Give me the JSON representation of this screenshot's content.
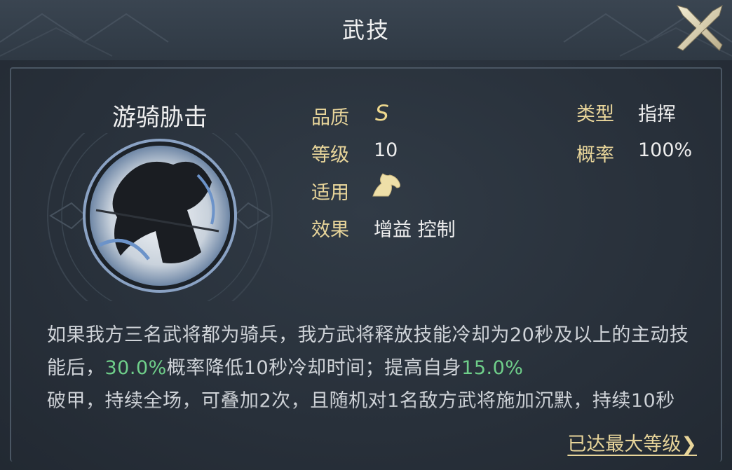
{
  "header": {
    "title": "武技"
  },
  "skill": {
    "name": "游骑胁击",
    "quality_label": "品质",
    "quality_value": "S",
    "level_label": "等级",
    "level_value": "10",
    "applicable_label": "适用",
    "applicable_icon": "horse-icon",
    "effect_label": "效果",
    "effect_value": "增益 控制",
    "type_label": "类型",
    "type_value": "指挥",
    "chance_label": "概率",
    "chance_value": "100%"
  },
  "description": {
    "part1": "如果我方三名武将都为骑兵，我方武将释放技能冷却为20秒及以上的主动技能后，",
    "hl1": "30.0%",
    "part2": "概率降低10秒冷却时间；提高自身",
    "hl2": "15.0%",
    "part3": "破甲，持续全场，可叠加2次，且随机对1名敌方武将施加沉默，持续10秒"
  },
  "footer": {
    "max_level_label": "已达最大等级❯"
  },
  "colors": {
    "accent_gold": "#e8d59a",
    "highlight_green": "#6fcf8a"
  }
}
